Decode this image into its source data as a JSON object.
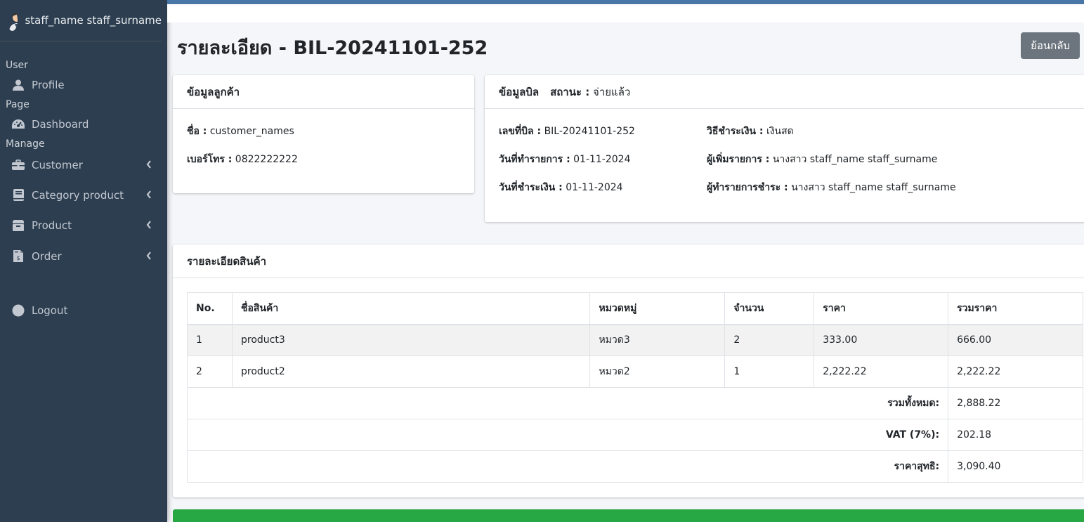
{
  "user": {
    "name": "staff_name staff_surname"
  },
  "nav": {
    "header_user": "User",
    "profile": "Profile",
    "header_page": "Page",
    "dashboard": "Dashboard",
    "header_manage": "Manage",
    "customer": "Customer",
    "category_product": "Category product",
    "product": "Product",
    "order": "Order",
    "logout": "Logout"
  },
  "page": {
    "title_main": "รายละเอียด",
    "title_sep": " - ",
    "bill_code": "BIL-20241101-252",
    "back_label": "ย้อนกลับ"
  },
  "customer": {
    "header": "ข้อมูลลูกค้า",
    "name_label": "ชื่อ :",
    "name_value": "customer_names",
    "phone_label": "เบอร์โทร :",
    "phone_value": "0822222222"
  },
  "bill": {
    "header": "ข้อมูลบิล",
    "status_label": "สถานะ :",
    "status_value": "จ่ายแล้ว",
    "bill_no_label": "เลขที่บิล :",
    "bill_no_value": "BIL-20241101-252",
    "txn_date_label": "วันที่ทำรายการ :",
    "txn_date_value": "01-11-2024",
    "pay_date_label": "วันที่ชำระเงิน :",
    "pay_date_value": "01-11-2024",
    "pay_method_label": "วิธีชำระเงิน :",
    "pay_method_value": "เงินสด",
    "added_by_label": "ผู้เพิ่มรายการ :",
    "added_by_value": "นางสาว staff_name staff_surname",
    "paid_by_label": "ผู้ทำรายการชำระ :",
    "paid_by_value": "นางสาว staff_name staff_surname"
  },
  "items": {
    "header": "รายละเอียดสินค้า",
    "columns": [
      "No.",
      "ชื่อสินค้า",
      "หมวดหมู่",
      "จำนวน",
      "ราคา",
      "รวมราคา"
    ],
    "rows": [
      [
        "1",
        "product3",
        "หมวด3",
        "2",
        "333.00",
        "666.00"
      ],
      [
        "2",
        "product2",
        "หมวด2",
        "1",
        "2,222.22",
        "2,222.22"
      ]
    ],
    "subtotal_label": "รวมทั้งหมด:",
    "subtotal_value": "2,888.22",
    "vat_label": "VAT (7%):",
    "vat_value": "202.18",
    "net_label": "ราคาสุทธิ:",
    "net_value": "3,090.40"
  },
  "colors": {
    "sidebar": "#2c3e50",
    "topbar_accent": "#4a76a8",
    "back_button": "#6c757d",
    "bottom_bar": "#28a745"
  }
}
